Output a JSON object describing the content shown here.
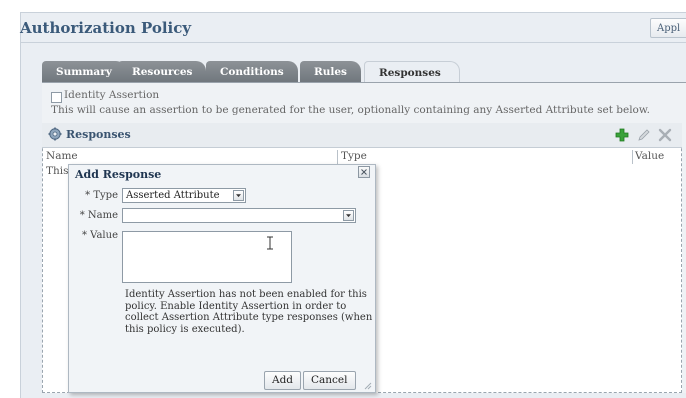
{
  "header": {
    "title": "Authorization Policy",
    "apply_label": "Appl"
  },
  "tabs": [
    {
      "label": "Summary"
    },
    {
      "label": "Resources"
    },
    {
      "label": "Conditions"
    },
    {
      "label": "Rules"
    },
    {
      "label": "Responses",
      "active": true
    }
  ],
  "identity_assertion": {
    "label": "Identity Assertion",
    "checked": false,
    "description": "This will cause an assertion to be generated for the user, optionally containing any Asserted Attribute set below."
  },
  "responses_panel": {
    "title": "Responses",
    "columns": [
      "Name",
      "Type",
      "Value"
    ],
    "row_text": "This",
    "toolbar_icons": [
      "add-icon",
      "edit-icon",
      "delete-icon"
    ]
  },
  "dialog": {
    "title": "Add Response",
    "type_label": "* Type",
    "type_value": "Asserted Attribute",
    "name_label": "* Name",
    "name_value": "",
    "value_label": "* Value",
    "info_text": "Identity Assertion has not been enabled for this policy. Enable Identity Assertion in order to collect Assertion Attribute type responses (when this policy is executed).",
    "add_label": "Add",
    "cancel_label": "Cancel"
  },
  "colors": {
    "title": "#3b5a7a",
    "tab_inactive": "#7b8187",
    "panel_bg": "#eaeef3",
    "add_icon": "#3aa23a"
  }
}
